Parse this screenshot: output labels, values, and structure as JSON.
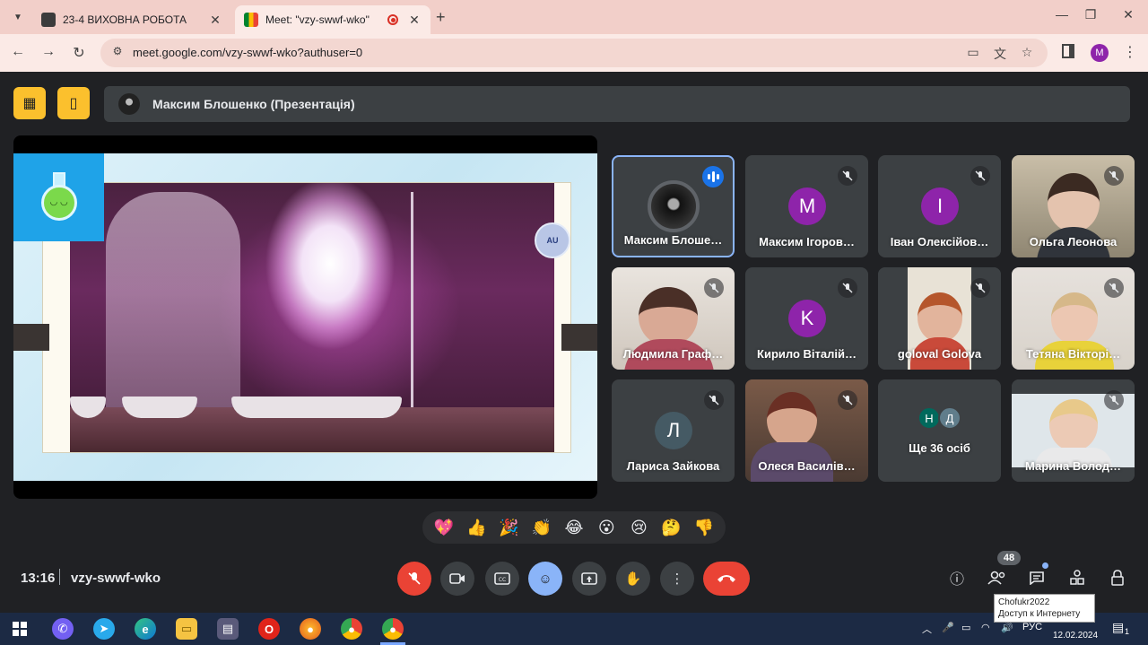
{
  "browser": {
    "tabs": [
      {
        "title": "23-4 ВИХОВНА РОБОТА",
        "active": false
      },
      {
        "title": "Meet: \"vzy-swwf-wko\"",
        "active": true
      }
    ],
    "url": "meet.google.com/vzy-swwf-wko?authuser=0",
    "profile_initial": "M"
  },
  "meet": {
    "presenter_label": "Максим Блошенко (Презентація)",
    "clock": "13:16",
    "meeting_code": "vzy-swwf-wko",
    "participant_count": "48",
    "participants": [
      {
        "name": "Максим Блоше…",
        "initial": "",
        "color": "",
        "speaking": true
      },
      {
        "name": "Максим Ігоров…",
        "initial": "M",
        "color": "#8e24aa"
      },
      {
        "name": "Іван Олексійов…",
        "initial": "I",
        "color": "#8e24aa"
      },
      {
        "name": "Ольга Леонова",
        "initial": "",
        "color": ""
      },
      {
        "name": "Людмила Граф…",
        "initial": "",
        "color": ""
      },
      {
        "name": "Кирило Віталій…",
        "initial": "K",
        "color": "#8e24aa"
      },
      {
        "name": "goloval Golova",
        "initial": "",
        "color": ""
      },
      {
        "name": "Тетяна Вікторі…",
        "initial": "",
        "color": ""
      },
      {
        "name": "Лариса Зайкова",
        "initial": "Л",
        "color": "#455a64"
      },
      {
        "name": "Олеся Василів…",
        "initial": "",
        "color": ""
      },
      {
        "name": "Ще 36 осіб",
        "initial": "",
        "color": ""
      },
      {
        "name": "Марина Волод…",
        "initial": "",
        "color": ""
      }
    ],
    "more_avatars": [
      {
        "initial": "Н",
        "color": "#00695c"
      },
      {
        "initial": "Д",
        "color": "#607d8b"
      }
    ],
    "reactions": [
      "💖",
      "👍",
      "🎉",
      "👏",
      "😂",
      "😮",
      "😢",
      "🤔",
      "👎"
    ],
    "tooltip": {
      "line1": "Chofukr2022",
      "line2": "Доступ к Интернету"
    }
  },
  "taskbar": {
    "lang": "РУС",
    "date": "12.02.2024",
    "notif_count": "1"
  }
}
